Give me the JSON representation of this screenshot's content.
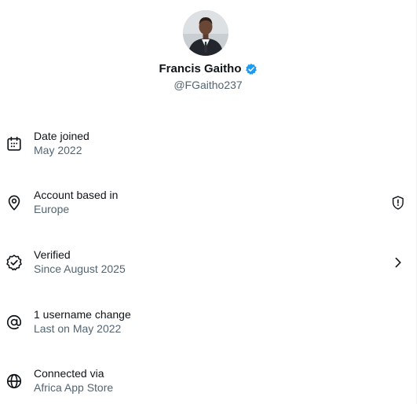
{
  "profile": {
    "name": "Francis Gaitho",
    "handle": "@FGaitho237",
    "verified_badge_color": "#1d9bf0"
  },
  "details": [
    {
      "icon": "calendar-icon",
      "title": "Date joined",
      "subtitle": "May 2022"
    },
    {
      "icon": "location-pin-icon",
      "title": "Account based in",
      "subtitle": "Europe",
      "trailing_icon": "shield-alert-icon"
    },
    {
      "icon": "verified-check-icon",
      "title": "Verified",
      "subtitle": "Since August 2025",
      "trailing_icon": "chevron-right-icon"
    },
    {
      "icon": "at-sign-icon",
      "title": "1 username change",
      "subtitle": "Last on May 2022"
    },
    {
      "icon": "globe-icon",
      "title": "Connected via",
      "subtitle": "Africa App Store"
    }
  ],
  "colors": {
    "text_primary": "#0f1419",
    "text_secondary": "#536471",
    "divider": "#eff3f4"
  }
}
